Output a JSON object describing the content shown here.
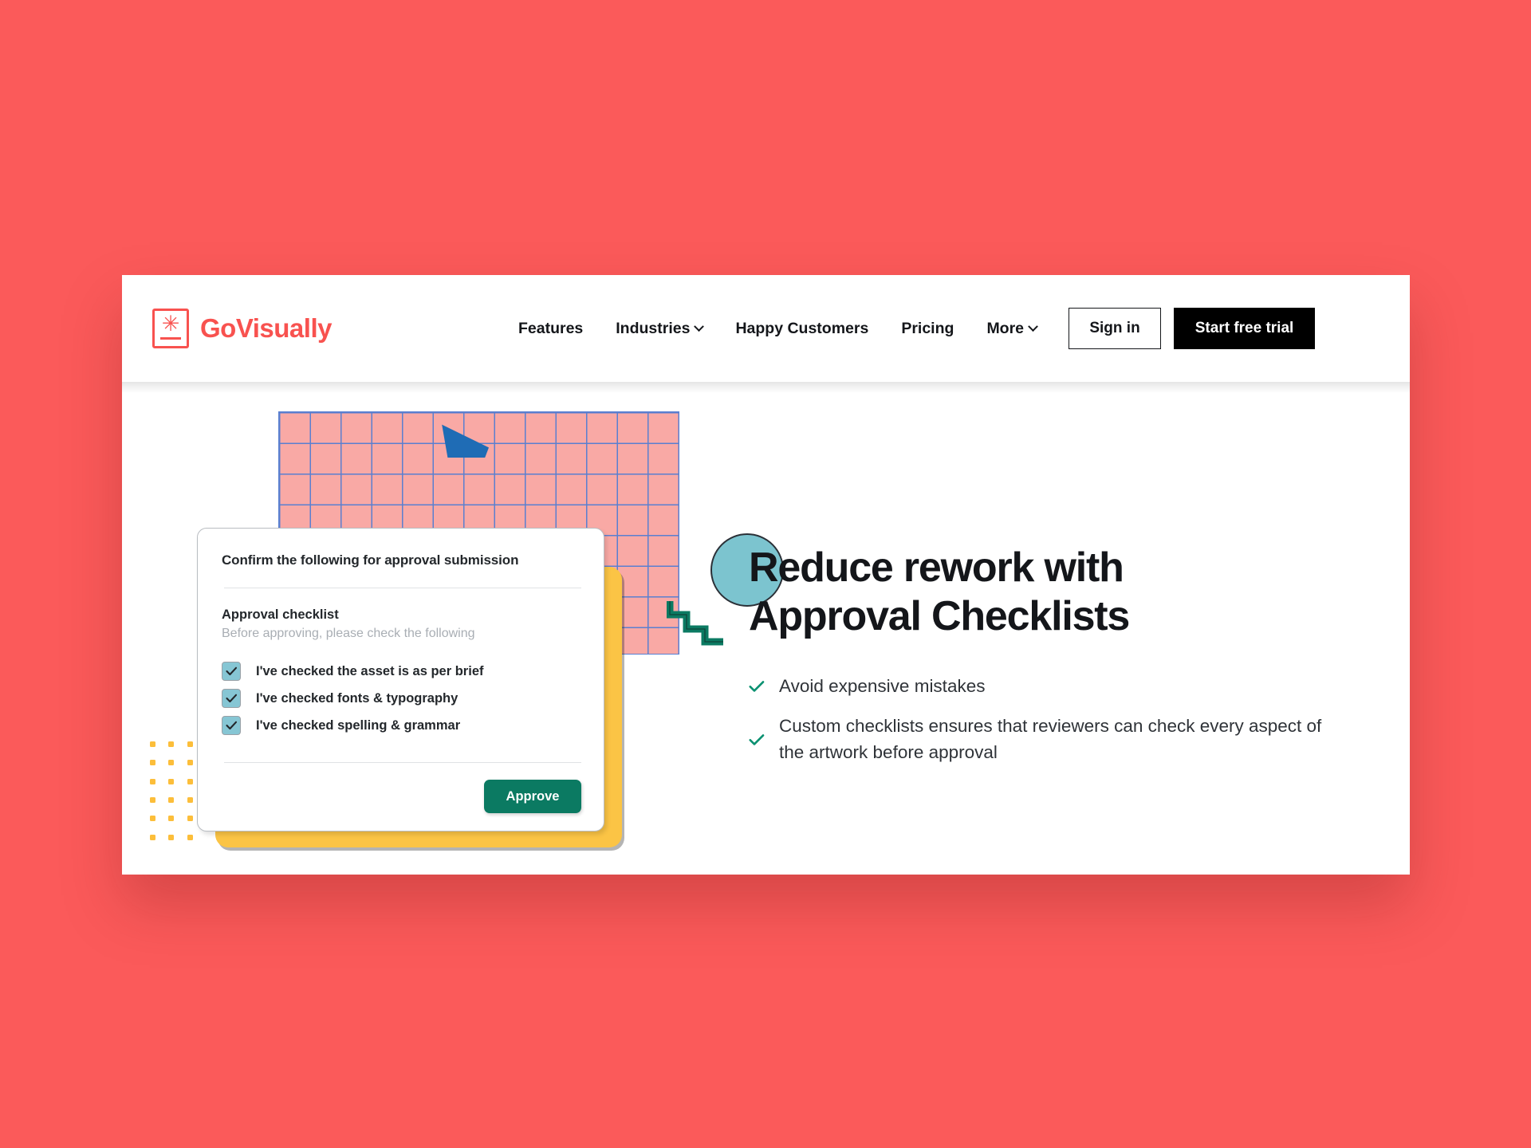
{
  "colors": {
    "background": "#fb5a5a",
    "brand": "#f8524f",
    "accent_green": "#0b7a62",
    "accent_teal": "#86c6d4",
    "accent_yellow": "#fbc445",
    "accent_blue": "#1f6cb5",
    "grid_pink": "#f9a9a5",
    "grid_line_blue": "#5a7fd0",
    "cta_black": "#000000"
  },
  "header": {
    "brand": {
      "name": "GoVisually",
      "mark_glyph": "✳"
    },
    "nav": [
      {
        "label": "Features",
        "has_dropdown": false
      },
      {
        "label": "Industries",
        "has_dropdown": true
      },
      {
        "label": "Happy Customers",
        "has_dropdown": false
      },
      {
        "label": "Pricing",
        "has_dropdown": false
      },
      {
        "label": "More",
        "has_dropdown": true
      }
    ],
    "actions": {
      "sign_in": "Sign in",
      "start_trial": "Start free trial"
    }
  },
  "hero": {
    "title_line1": "Reduce rework with",
    "title_line2": "Approval Checklists",
    "bullets": [
      "Avoid expensive mistakes",
      "Custom checklists ensures that reviewers can check every aspect of the artwork before approval"
    ]
  },
  "approval_card": {
    "title": "Confirm the following for approval submission",
    "section_title": "Approval checklist",
    "section_subtitle": "Before approving, please check the following",
    "items": [
      {
        "label": "I've checked the asset is as per brief",
        "checked": true
      },
      {
        "label": "I've checked fonts & typography",
        "checked": true
      },
      {
        "label": "I've checked spelling & grammar",
        "checked": true
      }
    ],
    "approve_button": "Approve"
  }
}
